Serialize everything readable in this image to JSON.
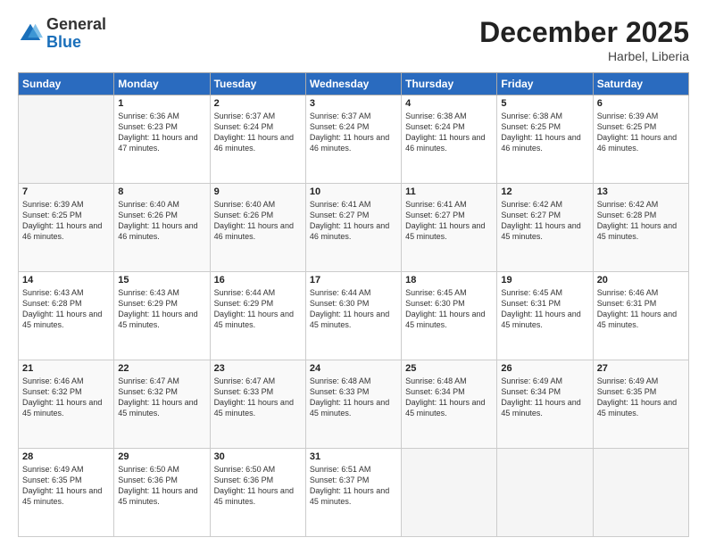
{
  "header": {
    "logo_general": "General",
    "logo_blue": "Blue",
    "title": "December 2025",
    "subtitle": "Harbel, Liberia"
  },
  "days_of_week": [
    "Sunday",
    "Monday",
    "Tuesday",
    "Wednesday",
    "Thursday",
    "Friday",
    "Saturday"
  ],
  "weeks": [
    [
      {
        "day": "",
        "sunrise": "",
        "sunset": "",
        "daylight": "",
        "empty": true
      },
      {
        "day": "1",
        "sunrise": "Sunrise: 6:36 AM",
        "sunset": "Sunset: 6:23 PM",
        "daylight": "Daylight: 11 hours and 47 minutes."
      },
      {
        "day": "2",
        "sunrise": "Sunrise: 6:37 AM",
        "sunset": "Sunset: 6:24 PM",
        "daylight": "Daylight: 11 hours and 46 minutes."
      },
      {
        "day": "3",
        "sunrise": "Sunrise: 6:37 AM",
        "sunset": "Sunset: 6:24 PM",
        "daylight": "Daylight: 11 hours and 46 minutes."
      },
      {
        "day": "4",
        "sunrise": "Sunrise: 6:38 AM",
        "sunset": "Sunset: 6:24 PM",
        "daylight": "Daylight: 11 hours and 46 minutes."
      },
      {
        "day": "5",
        "sunrise": "Sunrise: 6:38 AM",
        "sunset": "Sunset: 6:25 PM",
        "daylight": "Daylight: 11 hours and 46 minutes."
      },
      {
        "day": "6",
        "sunrise": "Sunrise: 6:39 AM",
        "sunset": "Sunset: 6:25 PM",
        "daylight": "Daylight: 11 hours and 46 minutes."
      }
    ],
    [
      {
        "day": "7",
        "sunrise": "Sunrise: 6:39 AM",
        "sunset": "Sunset: 6:25 PM",
        "daylight": "Daylight: 11 hours and 46 minutes."
      },
      {
        "day": "8",
        "sunrise": "Sunrise: 6:40 AM",
        "sunset": "Sunset: 6:26 PM",
        "daylight": "Daylight: 11 hours and 46 minutes."
      },
      {
        "day": "9",
        "sunrise": "Sunrise: 6:40 AM",
        "sunset": "Sunset: 6:26 PM",
        "daylight": "Daylight: 11 hours and 46 minutes."
      },
      {
        "day": "10",
        "sunrise": "Sunrise: 6:41 AM",
        "sunset": "Sunset: 6:27 PM",
        "daylight": "Daylight: 11 hours and 46 minutes."
      },
      {
        "day": "11",
        "sunrise": "Sunrise: 6:41 AM",
        "sunset": "Sunset: 6:27 PM",
        "daylight": "Daylight: 11 hours and 45 minutes."
      },
      {
        "day": "12",
        "sunrise": "Sunrise: 6:42 AM",
        "sunset": "Sunset: 6:27 PM",
        "daylight": "Daylight: 11 hours and 45 minutes."
      },
      {
        "day": "13",
        "sunrise": "Sunrise: 6:42 AM",
        "sunset": "Sunset: 6:28 PM",
        "daylight": "Daylight: 11 hours and 45 minutes."
      }
    ],
    [
      {
        "day": "14",
        "sunrise": "Sunrise: 6:43 AM",
        "sunset": "Sunset: 6:28 PM",
        "daylight": "Daylight: 11 hours and 45 minutes."
      },
      {
        "day": "15",
        "sunrise": "Sunrise: 6:43 AM",
        "sunset": "Sunset: 6:29 PM",
        "daylight": "Daylight: 11 hours and 45 minutes."
      },
      {
        "day": "16",
        "sunrise": "Sunrise: 6:44 AM",
        "sunset": "Sunset: 6:29 PM",
        "daylight": "Daylight: 11 hours and 45 minutes."
      },
      {
        "day": "17",
        "sunrise": "Sunrise: 6:44 AM",
        "sunset": "Sunset: 6:30 PM",
        "daylight": "Daylight: 11 hours and 45 minutes."
      },
      {
        "day": "18",
        "sunrise": "Sunrise: 6:45 AM",
        "sunset": "Sunset: 6:30 PM",
        "daylight": "Daylight: 11 hours and 45 minutes."
      },
      {
        "day": "19",
        "sunrise": "Sunrise: 6:45 AM",
        "sunset": "Sunset: 6:31 PM",
        "daylight": "Daylight: 11 hours and 45 minutes."
      },
      {
        "day": "20",
        "sunrise": "Sunrise: 6:46 AM",
        "sunset": "Sunset: 6:31 PM",
        "daylight": "Daylight: 11 hours and 45 minutes."
      }
    ],
    [
      {
        "day": "21",
        "sunrise": "Sunrise: 6:46 AM",
        "sunset": "Sunset: 6:32 PM",
        "daylight": "Daylight: 11 hours and 45 minutes."
      },
      {
        "day": "22",
        "sunrise": "Sunrise: 6:47 AM",
        "sunset": "Sunset: 6:32 PM",
        "daylight": "Daylight: 11 hours and 45 minutes."
      },
      {
        "day": "23",
        "sunrise": "Sunrise: 6:47 AM",
        "sunset": "Sunset: 6:33 PM",
        "daylight": "Daylight: 11 hours and 45 minutes."
      },
      {
        "day": "24",
        "sunrise": "Sunrise: 6:48 AM",
        "sunset": "Sunset: 6:33 PM",
        "daylight": "Daylight: 11 hours and 45 minutes."
      },
      {
        "day": "25",
        "sunrise": "Sunrise: 6:48 AM",
        "sunset": "Sunset: 6:34 PM",
        "daylight": "Daylight: 11 hours and 45 minutes."
      },
      {
        "day": "26",
        "sunrise": "Sunrise: 6:49 AM",
        "sunset": "Sunset: 6:34 PM",
        "daylight": "Daylight: 11 hours and 45 minutes."
      },
      {
        "day": "27",
        "sunrise": "Sunrise: 6:49 AM",
        "sunset": "Sunset: 6:35 PM",
        "daylight": "Daylight: 11 hours and 45 minutes."
      }
    ],
    [
      {
        "day": "28",
        "sunrise": "Sunrise: 6:49 AM",
        "sunset": "Sunset: 6:35 PM",
        "daylight": "Daylight: 11 hours and 45 minutes."
      },
      {
        "day": "29",
        "sunrise": "Sunrise: 6:50 AM",
        "sunset": "Sunset: 6:36 PM",
        "daylight": "Daylight: 11 hours and 45 minutes."
      },
      {
        "day": "30",
        "sunrise": "Sunrise: 6:50 AM",
        "sunset": "Sunset: 6:36 PM",
        "daylight": "Daylight: 11 hours and 45 minutes."
      },
      {
        "day": "31",
        "sunrise": "Sunrise: 6:51 AM",
        "sunset": "Sunset: 6:37 PM",
        "daylight": "Daylight: 11 hours and 45 minutes."
      },
      {
        "day": "",
        "sunrise": "",
        "sunset": "",
        "daylight": "",
        "empty": true
      },
      {
        "day": "",
        "sunrise": "",
        "sunset": "",
        "daylight": "",
        "empty": true
      },
      {
        "day": "",
        "sunrise": "",
        "sunset": "",
        "daylight": "",
        "empty": true
      }
    ]
  ]
}
